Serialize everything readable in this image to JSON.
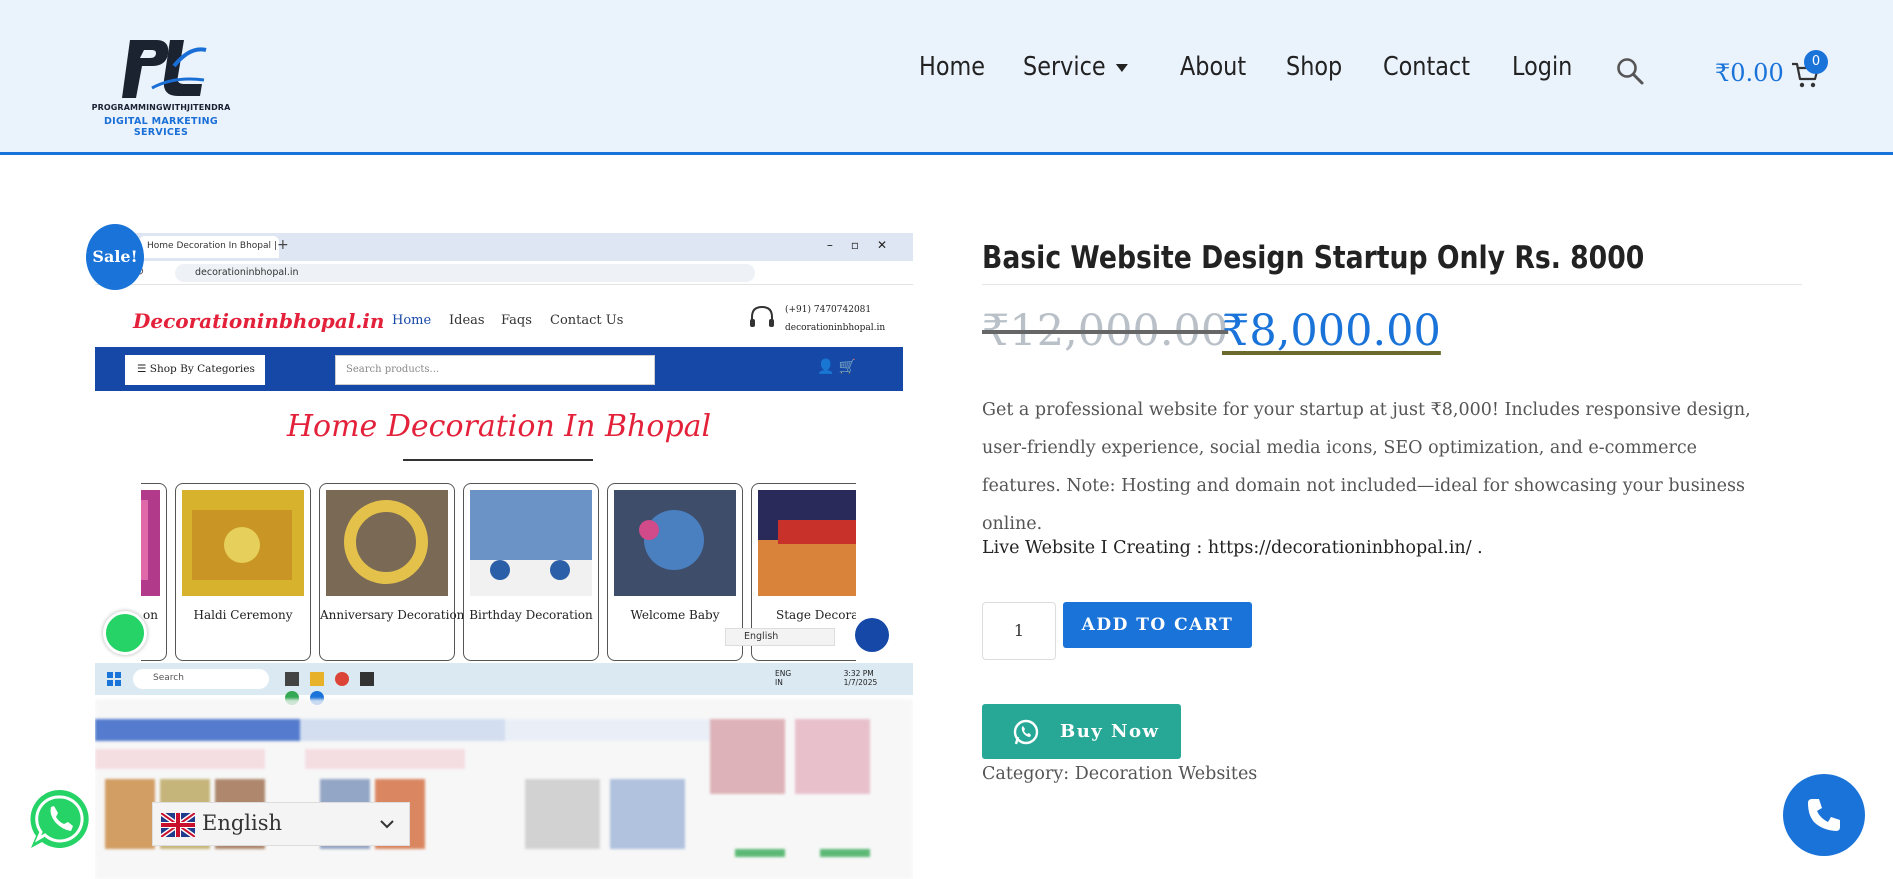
{
  "header": {
    "logo": {
      "line1": "PROGRAMMINGWITHJITENDRA",
      "line2": "DIGITAL MARKETING SERVICES"
    },
    "nav": [
      {
        "label": "Home"
      },
      {
        "label": "Service"
      },
      {
        "label": "About"
      },
      {
        "label": "Shop"
      },
      {
        "label": "Contact"
      },
      {
        "label": "Login"
      }
    ],
    "search_icon": "search-icon",
    "cart_total": "₹0.00",
    "cart_count": "0"
  },
  "gallery": {
    "sale_badge": "Sale!",
    "screenshot": {
      "tab_title": "Home Decoration In Bhopal | D",
      "address": "decorationinbhopal.in",
      "site_logo": "Decorationinbhopal.in",
      "site_nav": [
        "Home",
        "Ideas",
        "Faqs",
        "Contact Us"
      ],
      "phone": "(+91) 7470742081",
      "site_domain": "decorationinbhopal.in",
      "categories_button": "Shop By Categories",
      "search_placeholder": "Search products...",
      "page_title": "Home Decoration In Bhopal",
      "cards": [
        {
          "caption": "on"
        },
        {
          "caption": "Haldi Ceremony"
        },
        {
          "caption": "Anniversary Decoration"
        },
        {
          "caption": "Birthday Decoration"
        },
        {
          "caption": "Welcome Baby"
        },
        {
          "caption": "Stage Decoratic"
        }
      ],
      "lang_mini": "English",
      "taskbar_search": "Search",
      "taskbar_lang": "ENG",
      "taskbar_region": "IN",
      "taskbar_time": "3:32 PM",
      "taskbar_date": "1/7/2025"
    }
  },
  "product": {
    "title": "Basic Website Design Startup Only Rs. 8000",
    "old_price": "₹12,000.00",
    "new_price": "₹8,000.00",
    "description": "Get a professional website for your startup at just ₹8,000! Includes responsive design, user-friendly experience, social media icons, SEO optimization, and e-commerce features. Note: Hosting and domain not included—ideal for showcasing your business online.",
    "live_site": "Live Website I Creating : https://decorationinbhopal.in/ .",
    "quantity": "1",
    "add_to_cart": "ADD TO CART",
    "buy_now": "Buy Now",
    "category_label": "Category:",
    "category_value": "Decoration Websites"
  },
  "floating": {
    "language": "English",
    "whatsapp_icon": "whatsapp-icon",
    "call_icon": "phone-icon"
  },
  "colors": {
    "brand_blue": "#1a73d9",
    "header_bg": "#eaf2fc",
    "whatsapp_green": "#25d366",
    "buy_now_teal": "#27a897"
  }
}
